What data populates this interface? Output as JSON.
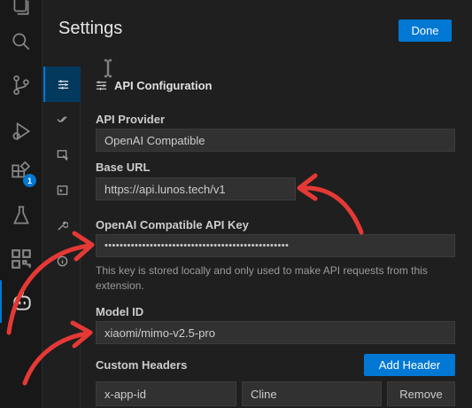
{
  "settings": {
    "title": "Settings",
    "done_label": "Done",
    "section_title": "API Configuration",
    "api_provider": {
      "label": "API Provider",
      "value": "OpenAI Compatible"
    },
    "base_url": {
      "label": "Base URL",
      "value": "https://api.lunos.tech/v1"
    },
    "api_key": {
      "label": "OpenAI Compatible API Key",
      "value": "•••••••••••••••••••••••••••••••••••••••••••••••••",
      "note": "This key is stored locally and only used to make API requests from this extension."
    },
    "model_id": {
      "label": "Model ID",
      "value": "xiaomi/mimo-v2.5-pro"
    },
    "custom_headers": {
      "label": "Custom Headers",
      "add_label": "Add Header",
      "rows": [
        {
          "name": "x-app-id",
          "value": "Cline",
          "remove_label": "Remove"
        }
      ]
    }
  },
  "activity_bar": {
    "extensions_badge": "1",
    "icons": [
      "explorer-icon",
      "search-icon",
      "source-control-icon",
      "run-debug-icon",
      "extensions-icon",
      "testing-icon",
      "qr-code-icon",
      "cline-bot-icon"
    ]
  },
  "tabs": [
    "api-configuration-icon",
    "features-icon",
    "browser-icon",
    "terminal-icon",
    "debug-tools-icon",
    "about-icon"
  ],
  "colors": {
    "accent": "#0078d4",
    "annotation_arrow": "#e53935",
    "background": "#1f1f1f"
  }
}
